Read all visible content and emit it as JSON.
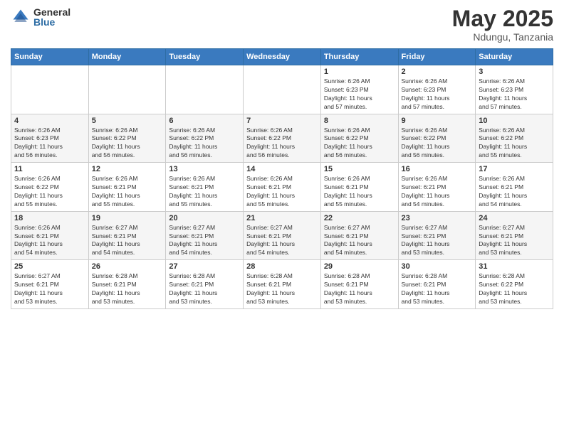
{
  "logo": {
    "general": "General",
    "blue": "Blue"
  },
  "title": {
    "month": "May 2025",
    "location": "Ndungu, Tanzania"
  },
  "calendar": {
    "headers": [
      "Sunday",
      "Monday",
      "Tuesday",
      "Wednesday",
      "Thursday",
      "Friday",
      "Saturday"
    ],
    "weeks": [
      [
        {
          "day": "",
          "content": ""
        },
        {
          "day": "",
          "content": ""
        },
        {
          "day": "",
          "content": ""
        },
        {
          "day": "",
          "content": ""
        },
        {
          "day": "1",
          "content": "Sunrise: 6:26 AM\nSunset: 6:23 PM\nDaylight: 11 hours\nand 57 minutes."
        },
        {
          "day": "2",
          "content": "Sunrise: 6:26 AM\nSunset: 6:23 PM\nDaylight: 11 hours\nand 57 minutes."
        },
        {
          "day": "3",
          "content": "Sunrise: 6:26 AM\nSunset: 6:23 PM\nDaylight: 11 hours\nand 57 minutes."
        }
      ],
      [
        {
          "day": "4",
          "content": "Sunrise: 6:26 AM\nSunset: 6:23 PM\nDaylight: 11 hours\nand 56 minutes."
        },
        {
          "day": "5",
          "content": "Sunrise: 6:26 AM\nSunset: 6:22 PM\nDaylight: 11 hours\nand 56 minutes."
        },
        {
          "day": "6",
          "content": "Sunrise: 6:26 AM\nSunset: 6:22 PM\nDaylight: 11 hours\nand 56 minutes."
        },
        {
          "day": "7",
          "content": "Sunrise: 6:26 AM\nSunset: 6:22 PM\nDaylight: 11 hours\nand 56 minutes."
        },
        {
          "day": "8",
          "content": "Sunrise: 6:26 AM\nSunset: 6:22 PM\nDaylight: 11 hours\nand 56 minutes."
        },
        {
          "day": "9",
          "content": "Sunrise: 6:26 AM\nSunset: 6:22 PM\nDaylight: 11 hours\nand 56 minutes."
        },
        {
          "day": "10",
          "content": "Sunrise: 6:26 AM\nSunset: 6:22 PM\nDaylight: 11 hours\nand 55 minutes."
        }
      ],
      [
        {
          "day": "11",
          "content": "Sunrise: 6:26 AM\nSunset: 6:22 PM\nDaylight: 11 hours\nand 55 minutes."
        },
        {
          "day": "12",
          "content": "Sunrise: 6:26 AM\nSunset: 6:21 PM\nDaylight: 11 hours\nand 55 minutes."
        },
        {
          "day": "13",
          "content": "Sunrise: 6:26 AM\nSunset: 6:21 PM\nDaylight: 11 hours\nand 55 minutes."
        },
        {
          "day": "14",
          "content": "Sunrise: 6:26 AM\nSunset: 6:21 PM\nDaylight: 11 hours\nand 55 minutes."
        },
        {
          "day": "15",
          "content": "Sunrise: 6:26 AM\nSunset: 6:21 PM\nDaylight: 11 hours\nand 55 minutes."
        },
        {
          "day": "16",
          "content": "Sunrise: 6:26 AM\nSunset: 6:21 PM\nDaylight: 11 hours\nand 54 minutes."
        },
        {
          "day": "17",
          "content": "Sunrise: 6:26 AM\nSunset: 6:21 PM\nDaylight: 11 hours\nand 54 minutes."
        }
      ],
      [
        {
          "day": "18",
          "content": "Sunrise: 6:26 AM\nSunset: 6:21 PM\nDaylight: 11 hours\nand 54 minutes."
        },
        {
          "day": "19",
          "content": "Sunrise: 6:27 AM\nSunset: 6:21 PM\nDaylight: 11 hours\nand 54 minutes."
        },
        {
          "day": "20",
          "content": "Sunrise: 6:27 AM\nSunset: 6:21 PM\nDaylight: 11 hours\nand 54 minutes."
        },
        {
          "day": "21",
          "content": "Sunrise: 6:27 AM\nSunset: 6:21 PM\nDaylight: 11 hours\nand 54 minutes."
        },
        {
          "day": "22",
          "content": "Sunrise: 6:27 AM\nSunset: 6:21 PM\nDaylight: 11 hours\nand 54 minutes."
        },
        {
          "day": "23",
          "content": "Sunrise: 6:27 AM\nSunset: 6:21 PM\nDaylight: 11 hours\nand 53 minutes."
        },
        {
          "day": "24",
          "content": "Sunrise: 6:27 AM\nSunset: 6:21 PM\nDaylight: 11 hours\nand 53 minutes."
        }
      ],
      [
        {
          "day": "25",
          "content": "Sunrise: 6:27 AM\nSunset: 6:21 PM\nDaylight: 11 hours\nand 53 minutes."
        },
        {
          "day": "26",
          "content": "Sunrise: 6:28 AM\nSunset: 6:21 PM\nDaylight: 11 hours\nand 53 minutes."
        },
        {
          "day": "27",
          "content": "Sunrise: 6:28 AM\nSunset: 6:21 PM\nDaylight: 11 hours\nand 53 minutes."
        },
        {
          "day": "28",
          "content": "Sunrise: 6:28 AM\nSunset: 6:21 PM\nDaylight: 11 hours\nand 53 minutes."
        },
        {
          "day": "29",
          "content": "Sunrise: 6:28 AM\nSunset: 6:21 PM\nDaylight: 11 hours\nand 53 minutes."
        },
        {
          "day": "30",
          "content": "Sunrise: 6:28 AM\nSunset: 6:21 PM\nDaylight: 11 hours\nand 53 minutes."
        },
        {
          "day": "31",
          "content": "Sunrise: 6:28 AM\nSunset: 6:22 PM\nDaylight: 11 hours\nand 53 minutes."
        }
      ]
    ]
  }
}
